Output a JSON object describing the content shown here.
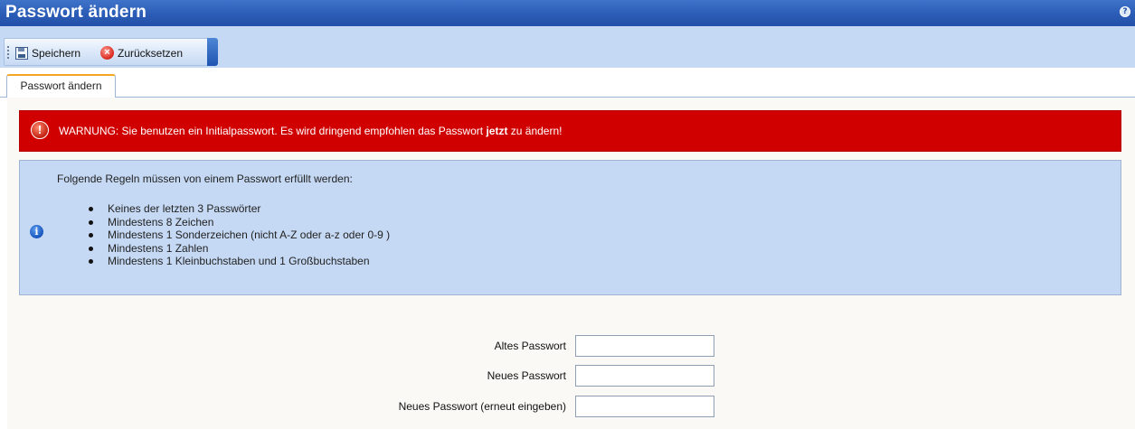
{
  "window": {
    "title": "Passwort ändern",
    "help_icon": "?"
  },
  "toolbar": {
    "save_label": "Speichern",
    "reset_label": "Zurücksetzen",
    "save_icon": "floppy-disk-icon",
    "reset_icon": "red-cancel-icon"
  },
  "tabs": [
    {
      "label": "Passwort ändern",
      "active": true
    }
  ],
  "warning": {
    "icon": "!",
    "text_before": "WARNUNG: Sie benutzen ein Initialpasswort. Es wird dringend empfohlen das Passwort ",
    "text_bold": "jetzt",
    "text_after": " zu ändern!",
    "background_color": "#d10000"
  },
  "info": {
    "icon": "i",
    "heading": "Folgende Regeln müssen von einem Passwort erfüllt werden:",
    "rules": [
      "Keines der letzten 3 Passwörter",
      "Mindestens 8 Zeichen",
      "Mindestens 1 Sonderzeichen (nicht A-Z oder a-z oder 0-9 )",
      "Mindestens 1 Zahlen",
      "Mindestens 1 Kleinbuchstaben und 1 Großbuchstaben"
    ],
    "background_color": "#c5d9f4"
  },
  "form": {
    "old_password_label": "Altes Passwort",
    "old_password_value": "",
    "new_password_label": "Neues Passwort",
    "new_password_value": "",
    "confirm_password_label": "Neues Passwort (erneut eingeben)",
    "confirm_password_value": ""
  },
  "colors": {
    "titlebar": "#2b5cb6",
    "accent_tab": "#f5a623",
    "panel": "#c5d9f4"
  }
}
